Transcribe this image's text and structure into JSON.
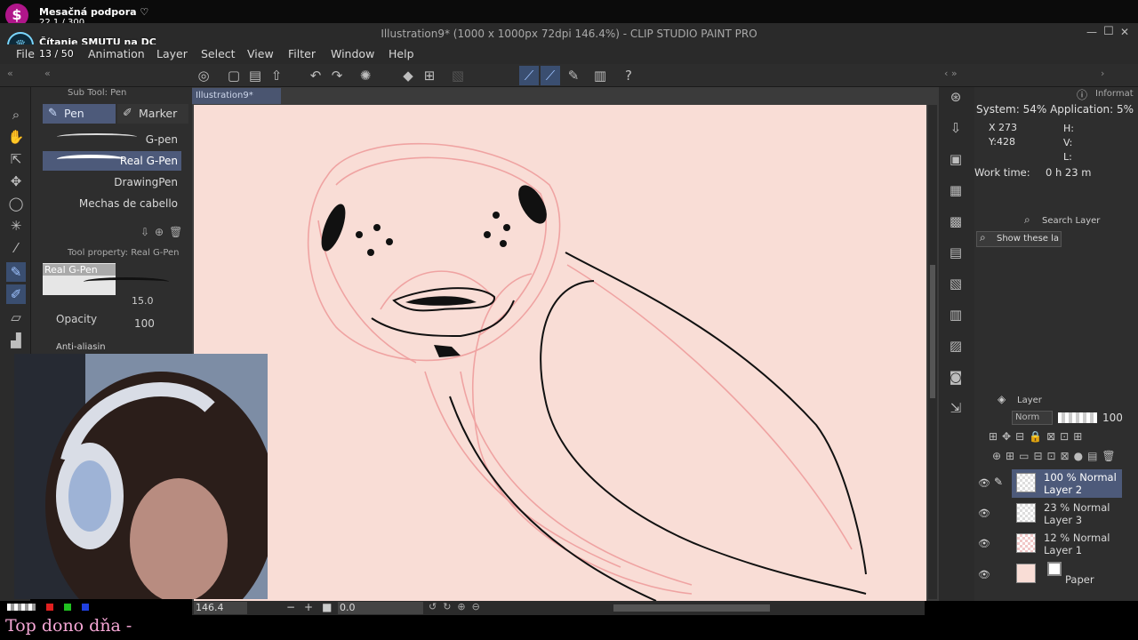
{
  "overlay": {
    "support_label": "Mesačná podpora ♡",
    "support_count": "22.1 / 300",
    "goal_label": "Čítanie SMUTU na DC",
    "goal_count": "13 / 50",
    "top_donor": "Top dono dňa -",
    "dollar_icon": "$"
  },
  "window": {
    "title": "Illustration9* (1000 x 1000px 72dpi 146.4%)  - CLIP STUDIO PAINT PRO",
    "minimize": "—",
    "maximize": "☐",
    "close": "✕"
  },
  "menu": [
    "File",
    "Animation",
    "Layer",
    "Select",
    "View",
    "Filter",
    "Window",
    "Help"
  ],
  "subtool": {
    "header": "Sub Tool: Pen",
    "tabs": [
      "Pen",
      "Marker"
    ],
    "brushes": [
      "G-pen",
      "Real G-Pen",
      "DrawingPen",
      "Mechas de cabello"
    ],
    "selected_brush": "Real G-Pen"
  },
  "toolprop": {
    "header": "Tool property: Real G-Pen",
    "preview_label": "Real G-Pen",
    "size_value": "15.0",
    "opacity_label": "Opacity",
    "opacity_value": "100",
    "antialias_label": "Anti-aliasin"
  },
  "document": {
    "tab": "Illustration9*"
  },
  "status": {
    "zoom": "146.4",
    "angle": "0.0"
  },
  "info": {
    "header": "Informat",
    "system": "System: 54% Application:  5%",
    "x": "X  273",
    "y": "Y:428",
    "h": "H:",
    "v": "V:",
    "l": "L:",
    "work_time_label": "Work time:",
    "work_time_value": "0 h 23 m"
  },
  "search_layer": {
    "header": "Search Layer",
    "show": "Show these la"
  },
  "layers_panel": {
    "header": "Layer",
    "blend": "Norm",
    "opacity": "100",
    "layers": [
      {
        "line1": "100 % Normal",
        "line2": "Layer 2"
      },
      {
        "line1": "23 % Normal",
        "line2": "Layer 3"
      },
      {
        "line1": "12 % Normal",
        "line2": "Layer 1"
      },
      {
        "line1": "",
        "line2": "Paper"
      }
    ]
  },
  "colors": {
    "canvas": "#f9ddd6",
    "sketch": "#ee9a9a",
    "selection": "#4d5a7a",
    "tab": "#4a5570"
  }
}
